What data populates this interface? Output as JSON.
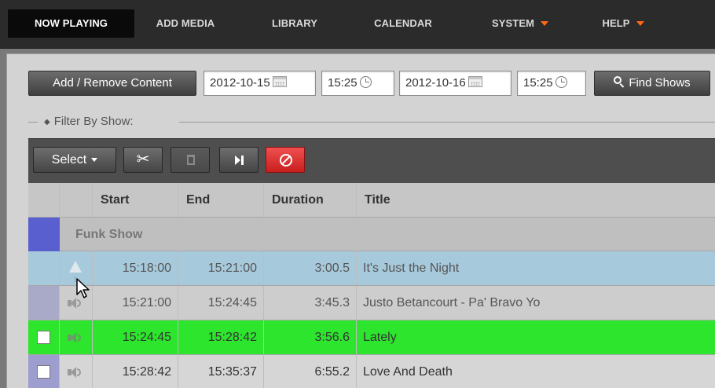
{
  "nav": {
    "items": [
      {
        "label": "NOW PLAYING",
        "active": true
      },
      {
        "label": "ADD MEDIA"
      },
      {
        "label": "LIBRARY"
      },
      {
        "label": "CALENDAR"
      },
      {
        "label": "SYSTEM",
        "dropdown": true
      },
      {
        "label": "HELP",
        "dropdown": true
      }
    ]
  },
  "search": {
    "add_remove_label": "Add / Remove Content",
    "start_date": "2012-10-15",
    "start_time": "15:25",
    "end_date": "2012-10-16",
    "end_time": "15:25",
    "find_label": "Find Shows"
  },
  "filter": {
    "label": "Filter By Show:"
  },
  "toolbar": {
    "select_label": "Select"
  },
  "table": {
    "headers": {
      "start": "Start",
      "end": "End",
      "duration": "Duration",
      "title": "Title"
    },
    "group": "Funk Show",
    "rows": [
      {
        "start": "15:18:00",
        "end": "15:21:00",
        "duration": "3:00.5",
        "title": "It's Just the Night",
        "state": "past",
        "icon": "warning-icon"
      },
      {
        "start": "15:21:00",
        "end": "15:24:45",
        "duration": "3:45.3",
        "title": "Justo Betancourt - Pa' Bravo Yo",
        "state": "past",
        "icon": "speaker-icon"
      },
      {
        "start": "15:24:45",
        "end": "15:28:42",
        "duration": "3:56.6",
        "title": "Lately",
        "state": "playing",
        "icon": "speaker-icon"
      },
      {
        "start": "15:28:42",
        "end": "15:35:37",
        "duration": "6:55.2",
        "title": "Love And Death",
        "state": "upcoming",
        "icon": "speaker-icon"
      }
    ]
  },
  "colors": {
    "playing": "#2ee52e",
    "past_highlight": "#a7c9dc",
    "past": "#cdcdcd",
    "group_swatch": "#5a5fcf",
    "nav_caret": "#ff6a13",
    "delete_button": "#e03434"
  }
}
